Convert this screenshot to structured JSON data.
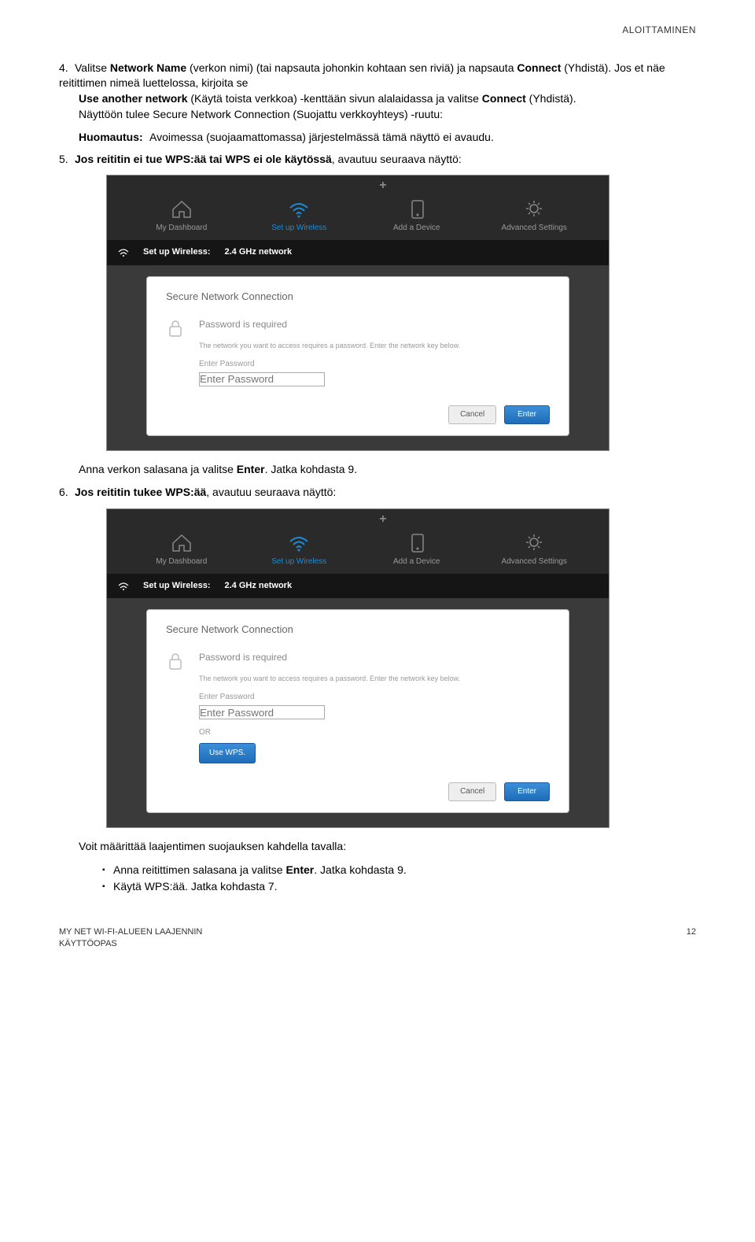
{
  "header": {
    "section": "ALOITTAMINEN"
  },
  "para4": {
    "num": "4.",
    "t1": "Valitse ",
    "b1": "Network Name",
    "t2": " (verkon nimi) (tai napsauta johonkin kohtaan sen riviä) ja napsauta ",
    "b2": "Connect",
    "t3": " (Yhdistä). Jos et näe reitittimen nimeä luettelossa, kirjoita se ",
    "b3": "Use another network",
    "t4": " (Käytä toista verkkoa) -kenttään sivun alalaidassa ja valitse ",
    "b4": "Connect",
    "t5": " (Yhdistä).",
    "line3": "Näyttöön tulee Secure Network Connection (Suojattu verkkoyhteys) -ruutu:"
  },
  "note": {
    "label": "Huomautus:",
    "text": "Avoimessa (suojaamattomassa) järjestelmässä tämä näyttö ei avaudu."
  },
  "para5": {
    "num": "5.",
    "b1": "Jos reititin ei tue WPS:ää tai WPS ei ole käytössä",
    "t1": ", avautuu seuraava näyttö:"
  },
  "shot": {
    "tabs": {
      "dash": "My Dashboard",
      "wireless": "Set up Wireless",
      "device": "Add a Device",
      "adv": "Advanced Settings"
    },
    "sub_label": "Set up Wireless:",
    "sub_net": "2.4 GHz network",
    "panel_title": "Secure Network Connection",
    "pw_req": "Password is required",
    "pw_desc": "The network you want to access requires a password. Enter the network key below.",
    "pw_ph": "Enter Password",
    "or": "OR",
    "wps_btn": "Use WPS.",
    "cancel": "Cancel",
    "enter": "Enter"
  },
  "after5": {
    "t1": "Anna verkon salasana ja valitse ",
    "b1": "Enter",
    "t2": ". Jatka kohdasta 9."
  },
  "para6": {
    "num": "6.",
    "b1": "Jos reititin tukee WPS:ää",
    "t1": ", avautuu seuraava näyttö:"
  },
  "after6": {
    "lead": "Voit määrittää laajentimen suojauksen kahdella tavalla:",
    "li1a": "Anna reitittimen salasana ja valitse ",
    "li1b": "Enter",
    "li1c": ". Jatka kohdasta 9.",
    "li2": "Käytä WPS:ää. Jatka kohdasta 7."
  },
  "footer": {
    "left1": "MY NET WI-FI-ALUEEN LAAJENNIN",
    "left2": "KÄYTTÖOPAS",
    "page": "12"
  }
}
